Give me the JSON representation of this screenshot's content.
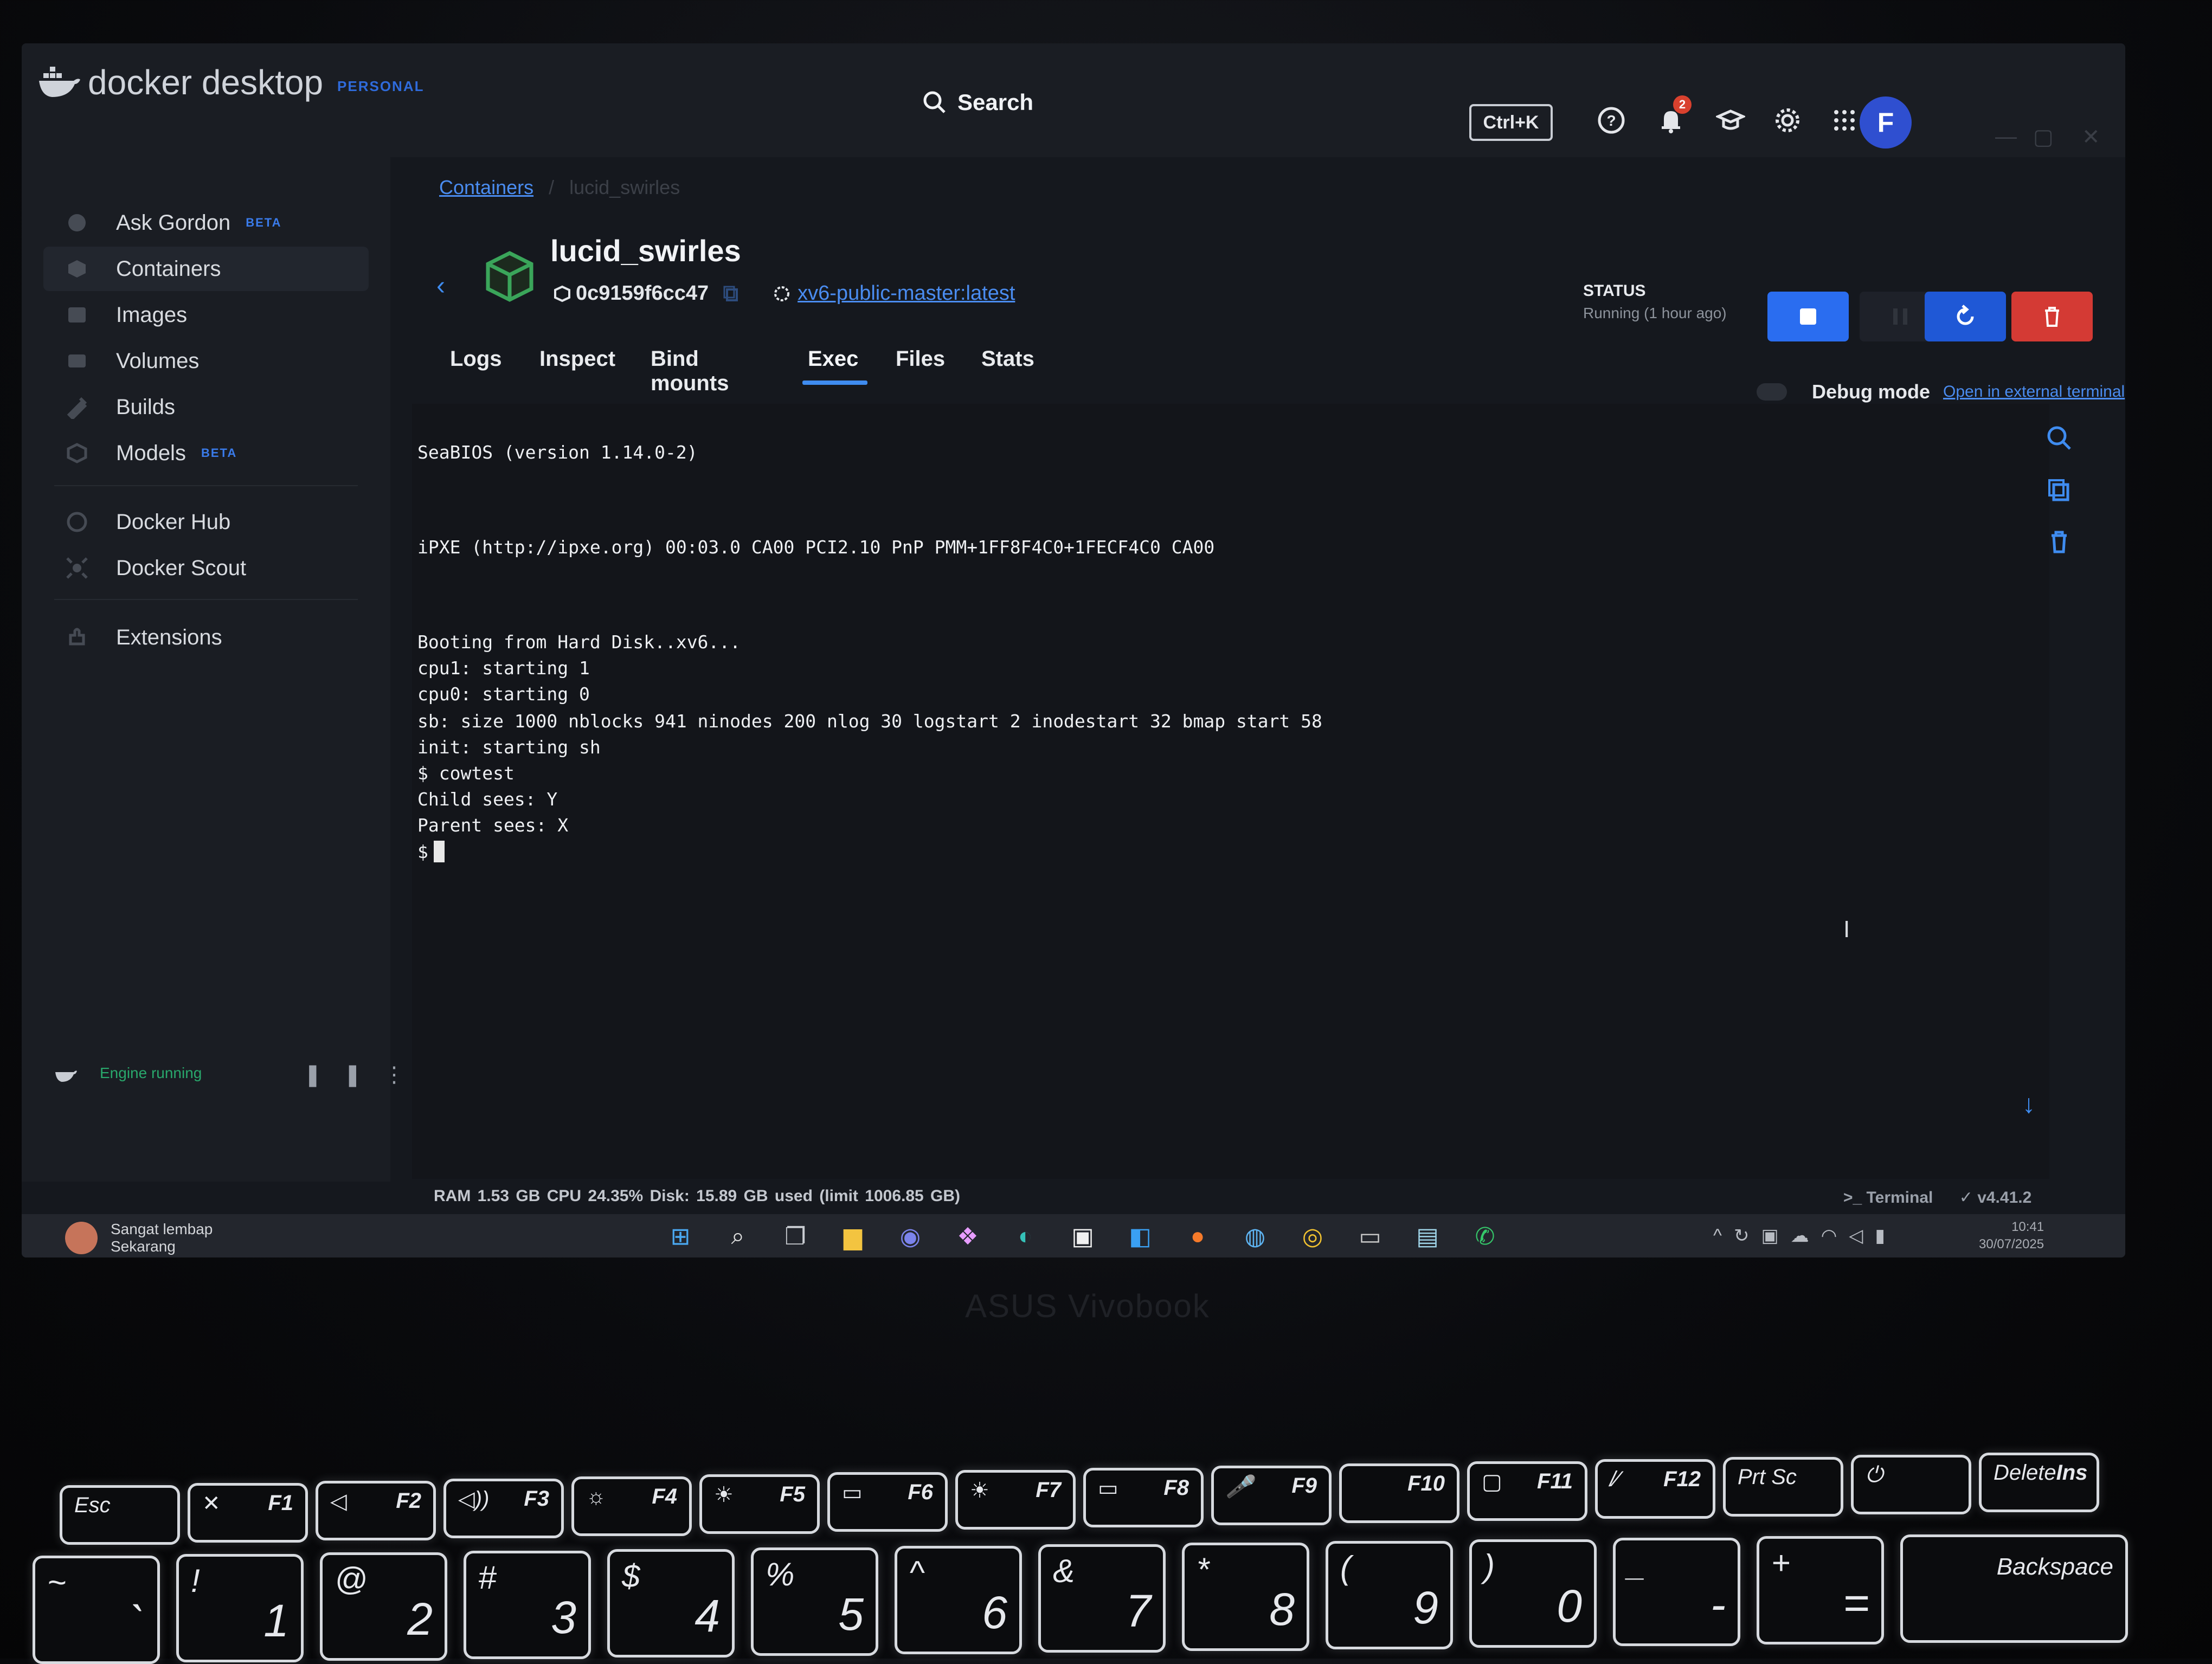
{
  "app": {
    "logo_text": "docker desktop",
    "edition_badge": "PERSONAL",
    "search_label": "Search",
    "shortcut": "Ctrl+K",
    "notification_count": "2",
    "avatar_initial": "F"
  },
  "sidebar": {
    "items": [
      {
        "label": "Ask Gordon",
        "badge": "BETA",
        "icon": "gordon-icon"
      },
      {
        "label": "Containers",
        "badge": "",
        "icon": "containers-icon"
      },
      {
        "label": "Images",
        "badge": "",
        "icon": "images-icon"
      },
      {
        "label": "Volumes",
        "badge": "",
        "icon": "volumes-icon"
      },
      {
        "label": "Builds",
        "badge": "",
        "icon": "builds-icon"
      },
      {
        "label": "Models",
        "badge": "BETA",
        "icon": "models-icon"
      },
      {
        "label": "Docker Hub",
        "badge": "",
        "icon": "docker-hub-icon"
      },
      {
        "label": "Docker Scout",
        "badge": "",
        "icon": "docker-scout-icon"
      },
      {
        "label": "Extensions",
        "badge": "",
        "icon": "extensions-icon"
      }
    ],
    "engine_status": "Engine running"
  },
  "breadcrumb": {
    "parent": "Containers",
    "current": "lucid_swirles"
  },
  "container": {
    "name": "lucid_swirles",
    "id": "0c9159f6cc47",
    "image": "xv6-public-master:latest",
    "status_label": "STATUS",
    "status_value": "Running (1 hour ago)"
  },
  "tabs": [
    "Logs",
    "Inspect",
    "Bind mounts",
    "Exec",
    "Files",
    "Stats"
  ],
  "active_tab": "Exec",
  "debug": {
    "label": "Debug mode",
    "link": "Open in external terminal"
  },
  "terminal": {
    "lines": [
      "SeaBIOS (version 1.14.0-2)",
      "iPXE (http://ipxe.org) 00:03.0 CA00 PCI2.10 PnP PMM+1FF8F4C0+1FECF4C0 CA00",
      "Booting from Hard Disk..xv6...",
      "cpu1: starting 1",
      "cpu0: starting 0",
      "sb: size 1000 nblocks 941 ninodes 200 nlog 30 logstart 2 inodestart 32 bmap start 58",
      "init: starting sh",
      "$ cowtest",
      "Child sees: Y",
      "Parent sees: X",
      "$"
    ]
  },
  "footer": {
    "stats": "RAM 1.53 GB  CPU 24.35%  Disk: 15.89 GB used (limit 1006.85 GB)",
    "terminal_label": "Terminal",
    "version": "v4.41.2"
  },
  "taskbar": {
    "weather_line1": "Sangat lembap",
    "weather_line2": "Sekarang",
    "time": "10:41",
    "date": "30/07/2025"
  },
  "laptop": {
    "brand": "ASUS Vivobook"
  },
  "keyboard": {
    "fn_row": [
      {
        "left": "Esc",
        "right": ""
      },
      {
        "left": "✕",
        "right": "F1"
      },
      {
        "left": "◁",
        "right": "F2"
      },
      {
        "left": "◁))",
        "right": "F3"
      },
      {
        "left": "☼",
        "right": "F4"
      },
      {
        "left": "☀",
        "right": "F5"
      },
      {
        "left": "▭",
        "right": "F6"
      },
      {
        "left": "☀",
        "right": "F7"
      },
      {
        "left": "▭",
        "right": "F8"
      },
      {
        "left": "🎤",
        "right": "F9"
      },
      {
        "left": "",
        "right": "F10"
      },
      {
        "left": "▢",
        "right": "F11"
      },
      {
        "left": "/⁄",
        "right": "F12"
      },
      {
        "left": "Prt Sc",
        "right": ""
      },
      {
        "left": "⏻",
        "right": ""
      },
      {
        "left": "Delete",
        "right": "Ins"
      }
    ],
    "num_row": [
      {
        "top": "~",
        "main": "`"
      },
      {
        "top": "!",
        "main": "1"
      },
      {
        "top": "@",
        "main": "2"
      },
      {
        "top": "#",
        "main": "3"
      },
      {
        "top": "$",
        "main": "4"
      },
      {
        "top": "%",
        "main": "5"
      },
      {
        "top": "^",
        "main": "6"
      },
      {
        "top": "&",
        "main": "7"
      },
      {
        "top": "*",
        "main": "8"
      },
      {
        "top": "(",
        "main": "9"
      },
      {
        "top": ")",
        "main": "0"
      },
      {
        "top": "_",
        "main": "-"
      },
      {
        "top": "+",
        "main": "="
      },
      {
        "top": "",
        "main": "Backspace"
      }
    ]
  },
  "colors": {
    "accent": "#3f8cf0",
    "stop_button": "#2a6df0",
    "restart_button": "#1f58d6",
    "delete_button": "#d43a34",
    "engine_running": "#29a86c"
  }
}
